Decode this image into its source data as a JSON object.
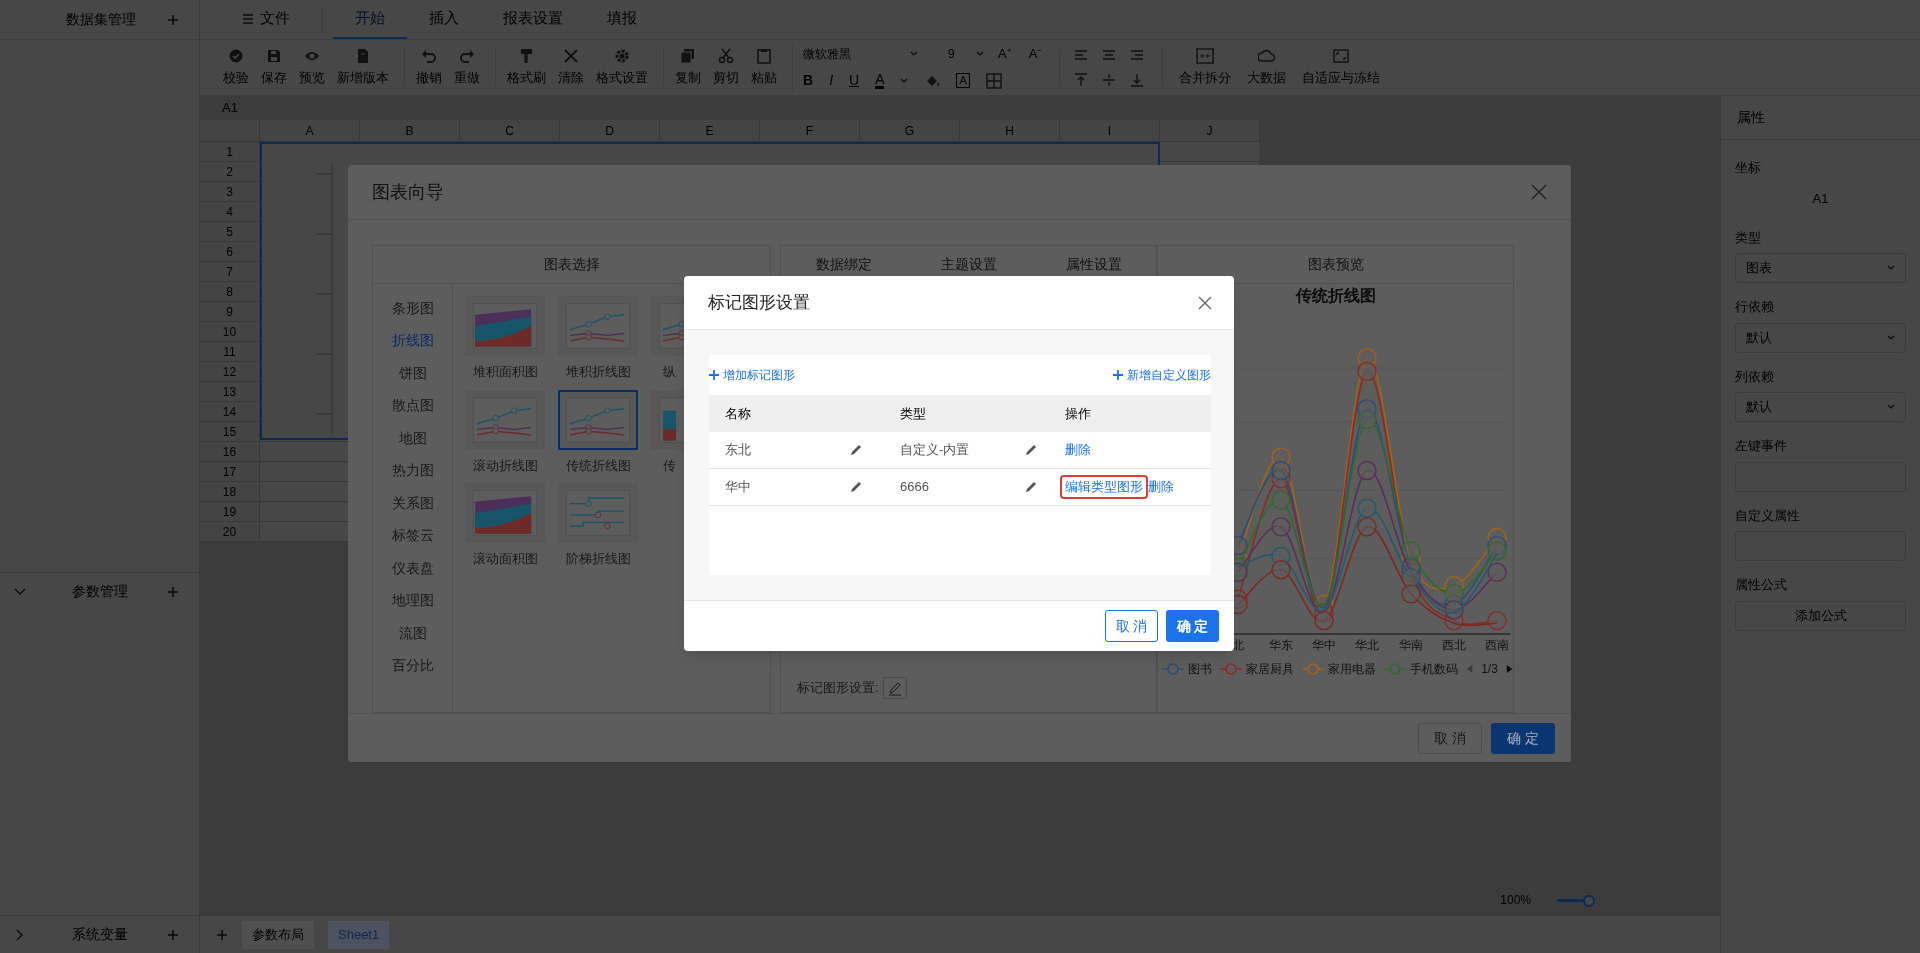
{
  "left_panel": {
    "dataset_header": "数据集管理",
    "sections": [
      {
        "title": "参数管理",
        "expanded": true
      },
      {
        "title": "系统变量",
        "expanded": false
      }
    ]
  },
  "menu_tabs": [
    {
      "label": "文件",
      "selected": false
    },
    {
      "label": "开始",
      "selected": true
    },
    {
      "label": "插入",
      "selected": false
    },
    {
      "label": "报表设置",
      "selected": false
    },
    {
      "label": "填报",
      "selected": false
    }
  ],
  "toolbar": {
    "groups": [
      [
        "校验",
        "保存",
        "预览",
        "新增版本"
      ],
      [
        "撤销",
        "重做"
      ],
      [
        "格式刷",
        "清除",
        "格式设置"
      ],
      [
        "复制",
        "剪切",
        "粘贴"
      ]
    ],
    "font": {
      "family": "微软雅黑",
      "size": "9",
      "grow": "A⁺",
      "shrink": "A⁻",
      "bold": "B",
      "italic": "I",
      "underline": "U",
      "font_color": "A",
      "boxed": "A"
    },
    "tail": [
      "合并拆分",
      "大数据",
      "自适应与冻结"
    ]
  },
  "sheet": {
    "name_box": "A1",
    "columns": [
      "A",
      "B",
      "C",
      "D",
      "E",
      "F",
      "G",
      "H",
      "I",
      "J"
    ],
    "rows": [
      "1",
      "2",
      "3",
      "4",
      "5",
      "6",
      "7",
      "8",
      "9",
      "10",
      "11",
      "12",
      "13",
      "14",
      "15",
      "16",
      "17",
      "18",
      "19",
      "20"
    ],
    "zoom": {
      "reading": "100%",
      "level": 1
    },
    "tabs": [
      {
        "label": "参数布局",
        "selected": false
      },
      {
        "label": "Sheet1",
        "selected": true
      }
    ]
  },
  "properties": {
    "title": "属性",
    "fields": [
      {
        "label": "坐标",
        "kind": "text",
        "value": "A1"
      },
      {
        "label": "类型",
        "kind": "select",
        "value": "图表"
      },
      {
        "label": "行依赖",
        "kind": "select",
        "value": "默认"
      },
      {
        "label": "列依赖",
        "kind": "select",
        "value": "默认"
      },
      {
        "label": "左键事件",
        "kind": "input"
      },
      {
        "label": "自定义属性",
        "kind": "input"
      },
      {
        "label": "属性公式",
        "kind": "button",
        "value": "添加公式"
      }
    ]
  },
  "wizard": {
    "title": "图表向导",
    "chart_select": {
      "title": "图表选择",
      "categories": [
        {
          "label": "条形图",
          "selected": false
        },
        {
          "label": "折线图",
          "selected": true
        },
        {
          "label": "饼图",
          "selected": false
        },
        {
          "label": "散点图",
          "selected": false
        },
        {
          "label": "地图",
          "selected": false
        },
        {
          "label": "热力图",
          "selected": false
        },
        {
          "label": "关系图",
          "selected": false
        },
        {
          "label": "标签云",
          "selected": false
        },
        {
          "label": "仪表盘",
          "selected": false
        },
        {
          "label": "地理图",
          "selected": false
        },
        {
          "label": "流图",
          "selected": false
        },
        {
          "label": "百分比",
          "selected": false
        }
      ],
      "types": [
        {
          "label": "堆积面积图",
          "selected": false
        },
        {
          "label": "堆积折线图",
          "selected": false
        },
        {
          "label": "纵",
          "selected": false
        },
        {
          "label": "滚动折线图",
          "selected": false
        },
        {
          "label": "传统折线图",
          "selected": true
        },
        {
          "label": "传",
          "selected": false
        },
        {
          "label": "滚动面积图",
          "selected": false
        },
        {
          "label": "阶梯折线图",
          "selected": false
        }
      ]
    },
    "config_tabs": [
      "数据绑定",
      "主题设置",
      "属性设置"
    ],
    "marker_label": "标记图形设置:",
    "preview": {
      "title": "图表预览",
      "chart_title": "传统折线图",
      "x_labels": [
        "北",
        "华东",
        "华中",
        "华北",
        "华南",
        "西北",
        "西南"
      ],
      "legend": [
        {
          "name": "图书",
          "color": "#2a4c78"
        },
        {
          "name": "家居厨具",
          "color": "#8c2a24"
        },
        {
          "name": "家用电器",
          "color": "#a4621a"
        },
        {
          "name": "手机数码",
          "color": "#2e6a2e"
        }
      ],
      "page": "1/3"
    },
    "buttons": [
      "取 消",
      "确 定"
    ]
  },
  "modal": {
    "title": "标记图形设置",
    "add_link": "增加标记图形",
    "add_custom_link": "新增自定义图形",
    "columns": [
      "名称",
      "类型",
      "操作"
    ],
    "rows": [
      {
        "name": "东北",
        "type": "自定义-内置",
        "actions": [
          {
            "label": "删除",
            "highlighted": false
          }
        ]
      },
      {
        "name": "华中",
        "type": "6666",
        "actions": [
          {
            "label": "编辑类型图形",
            "highlighted": true
          },
          {
            "label": "删除",
            "highlighted": false
          }
        ]
      }
    ],
    "buttons": [
      "取 消",
      "确 定"
    ]
  }
}
